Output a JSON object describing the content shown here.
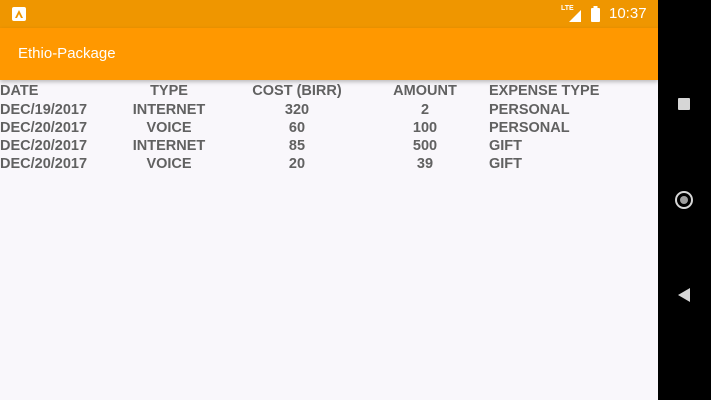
{
  "status_bar": {
    "network": "LTE",
    "time": "10:37"
  },
  "app_bar": {
    "title": "Ethio-Package"
  },
  "table": {
    "headers": {
      "date": "DATE",
      "type": "TYPE",
      "cost": "COST (BIRR)",
      "amount": "AMOUNT",
      "expense_type": "EXPENSE TYPE"
    },
    "rows": [
      {
        "date": "DEC/19/2017",
        "type": "INTERNET",
        "cost": "320",
        "amount": "2",
        "expense_type": "PERSONAL"
      },
      {
        "date": "DEC/20/2017",
        "type": "VOICE",
        "cost": "60",
        "amount": "100",
        "expense_type": "PERSONAL"
      },
      {
        "date": "DEC/20/2017",
        "type": "INTERNET",
        "cost": "85",
        "amount": "500",
        "expense_type": "GIFT"
      },
      {
        "date": "DEC/20/2017",
        "type": "VOICE",
        "cost": "20",
        "amount": "39",
        "expense_type": "GIFT"
      }
    ]
  },
  "colors": {
    "status_bar": "#ef9600",
    "app_bar": "#ff9800",
    "table_text": "#616161",
    "background": "#f9f7fb"
  },
  "icons": {
    "notification": "app-notification-icon",
    "signal": "lte-signal-icon",
    "battery": "battery-icon",
    "nav_recents": "recents-square-icon",
    "nav_home": "home-circle-icon",
    "nav_back": "back-triangle-icon"
  }
}
